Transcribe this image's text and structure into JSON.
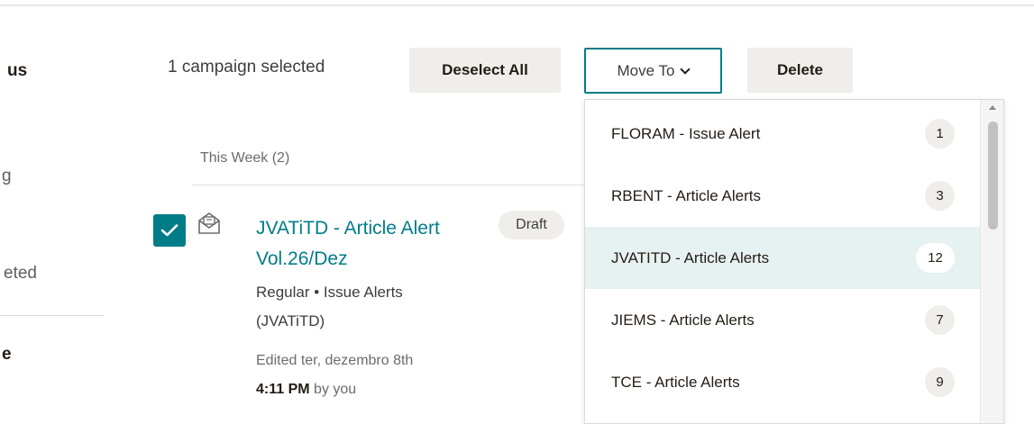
{
  "sidebar": {
    "status_label": "us",
    "item_1": "g",
    "item_2": "eted",
    "item_3": "e"
  },
  "toolbar": {
    "selected_text": "1 campaign selected",
    "deselect_label": "Deselect All",
    "move_to_label": "Move To",
    "delete_label": "Delete"
  },
  "section": {
    "week_label": "This Week (2)"
  },
  "campaign": {
    "title": "JVATiTD - Article Alert Vol.26/Dez",
    "type": "Regular • Issue Alerts",
    "list": "(JVATiTD)",
    "edited": "Edited ter, dezembro 8th",
    "edited_time": "4:11 PM",
    "edited_by": " by you",
    "status": "Draft",
    "checked": true
  },
  "dropdown": {
    "items": [
      {
        "label": "FLORAM - Issue Alert",
        "count": "1"
      },
      {
        "label": "RBENT - Article Alerts",
        "count": "3"
      },
      {
        "label": "JVATITD - Article Alerts",
        "count": "12",
        "active": true
      },
      {
        "label": "JIEMS - Article Alerts",
        "count": "7"
      },
      {
        "label": "TCE - Article Alerts",
        "count": "9"
      }
    ]
  },
  "colors": {
    "accent": "#007c89",
    "button_bg": "#efeeea",
    "active_row": "#e6f1f2"
  },
  "icons": {
    "mail": "envelope-open-icon",
    "check": "checkmark-icon",
    "chevron": "chevron-down-icon"
  }
}
